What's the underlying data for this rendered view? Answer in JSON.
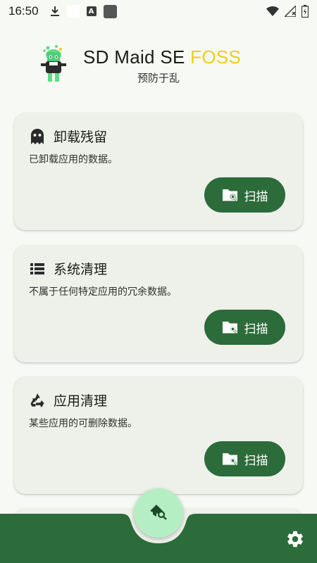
{
  "status_bar": {
    "time": "16:50",
    "icons": [
      "download-icon",
      "blank-notification-icon",
      "a-badge-icon",
      "square-app-icon",
      "wifi-icon",
      "signal-icon",
      "battery-icon"
    ]
  },
  "header": {
    "title_main": "SD Maid SE ",
    "title_accent": "FOSS",
    "subtitle": "预防于乱",
    "accent_color": "#f2cc1a"
  },
  "cards": [
    {
      "icon": "ghost-icon",
      "title": "卸载残留",
      "description": "已卸载应用的数据。",
      "button_label": "扫描",
      "button_icon": "folder-search-icon"
    },
    {
      "icon": "list-icon",
      "title": "系统清理",
      "description": "不属于任何特定应用的冗余数据。",
      "button_label": "扫描",
      "button_icon": "folder-search-icon"
    },
    {
      "icon": "recycle-icon",
      "title": "应用清理",
      "description": "某些应用的可删除数据。",
      "button_label": "扫描",
      "button_icon": "folder-search-icon"
    }
  ],
  "bottom_bar": {
    "fab_icon": "broom-search-icon",
    "settings_icon": "gear-icon",
    "color": "#2c6b3a"
  }
}
